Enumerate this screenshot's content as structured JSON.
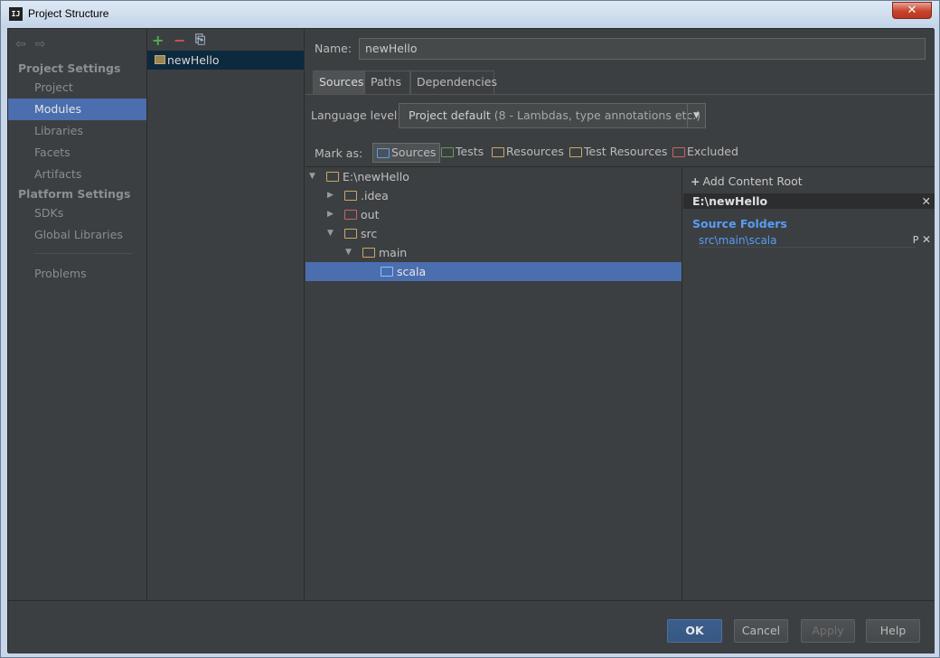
{
  "window": {
    "title": "Project Structure",
    "app_icon_text": "IJ",
    "close_glyph": "✕"
  },
  "nav": {
    "back_glyph": "⇦",
    "forward_glyph": "⇨",
    "project_settings_header": "Project Settings",
    "platform_settings_header": "Platform Settings",
    "items": [
      "Project",
      "Modules",
      "Libraries",
      "Facets",
      "Artifacts",
      "SDKs",
      "Global Libraries",
      "Problems"
    ],
    "selected": "Modules"
  },
  "modules": {
    "add_glyph": "+",
    "remove_glyph": "−",
    "copy_glyph": "⎘",
    "list": [
      "newHello"
    ]
  },
  "module": {
    "name_label": "Name:",
    "name_value": "newHello",
    "tabs": [
      "Sources",
      "Paths",
      "Dependencies"
    ],
    "active_tab": "Sources",
    "language_level_label": "Language level:",
    "language_level_value": "Project default",
    "language_level_detail": "(8 - Lambdas, type annotations etc.)",
    "mark_as_label": "Mark as:",
    "mark_buttons": [
      "Sources",
      "Tests",
      "Resources",
      "Test Resources",
      "Excluded"
    ],
    "selected_mark": "Sources"
  },
  "tree": [
    {
      "label": "E:\\newHello",
      "arrow": "▼",
      "folder": "source-root"
    },
    {
      "label": ".idea",
      "arrow": "▶",
      "folder": "plain"
    },
    {
      "label": "out",
      "arrow": "▶",
      "folder": "excluded"
    },
    {
      "label": "src",
      "arrow": "▼",
      "folder": "plain"
    },
    {
      "label": "main",
      "arrow": "▼",
      "folder": "plain"
    },
    {
      "label": "scala",
      "arrow": "",
      "folder": "source",
      "selected": true
    }
  ],
  "content_root": {
    "add_label": "Add Content Root",
    "add_glyph": "+",
    "root_path": "E:\\newHello",
    "remove_glyph": "✕",
    "source_folders_title": "Source Folders",
    "source_folder": "src\\main\\scala",
    "source_props_glyph": "P",
    "source_remove_glyph": "✕"
  },
  "buttons": {
    "ok": "OK",
    "cancel": "Cancel",
    "apply": "Apply",
    "help": "Help"
  },
  "colors": {
    "background": "#3c3f41",
    "selection": "#4b6eaf",
    "source_folder": "#589df6",
    "test_folder": "#6a9955",
    "resource_folder": "#c9a868",
    "excluded_folder": "#c86464"
  }
}
